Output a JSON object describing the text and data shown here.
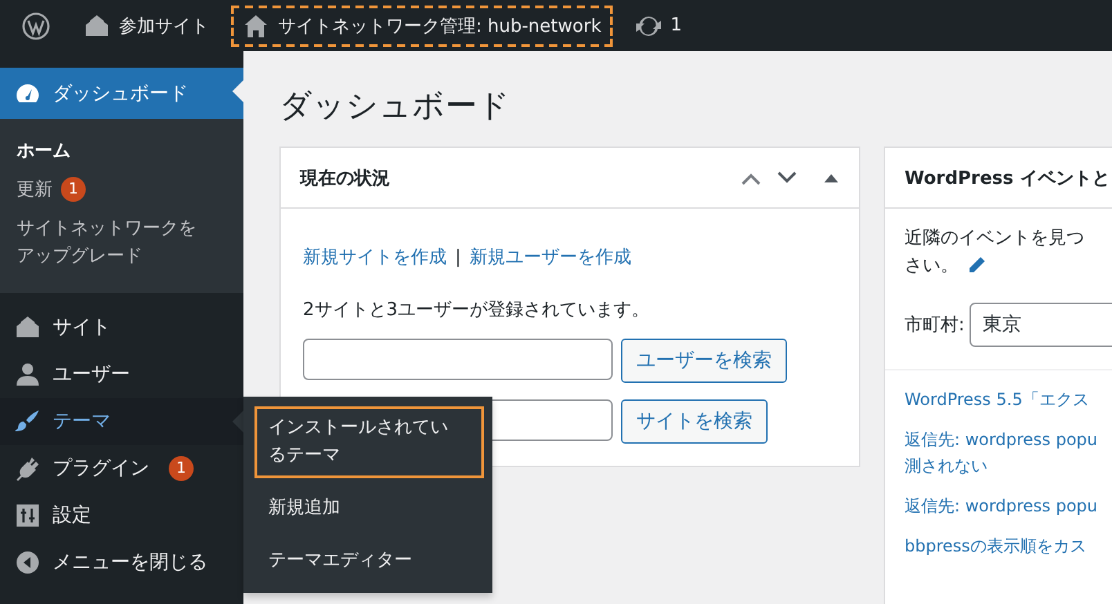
{
  "admin_bar": {
    "items": [
      {
        "kind": "logo"
      },
      {
        "kind": "sites",
        "label": "参加サイト",
        "highlighted": false
      },
      {
        "kind": "home",
        "label": "サイトネットワーク管理: hub-network",
        "highlighted": true
      },
      {
        "kind": "updates",
        "label": "1",
        "highlighted": false
      }
    ]
  },
  "sidebar": {
    "items": [
      {
        "label": "ダッシュボード",
        "selected": true,
        "expanded": false,
        "submenu": [
          {
            "label": "ホーム",
            "selected": true
          },
          {
            "label": "更新",
            "selected": false,
            "badge": "1"
          },
          {
            "label": "サイトネットワークをアップグレード",
            "selected": false
          }
        ]
      },
      {
        "label": "サイト",
        "selected": false,
        "expanded": false
      },
      {
        "label": "ユーザー",
        "selected": false,
        "expanded": false
      },
      {
        "label": "テーマ",
        "selected": false,
        "expanded": true,
        "flyout": [
          {
            "label": "インストールされているテーマ",
            "highlighted": true
          },
          {
            "label": "新規追加",
            "highlighted": false
          },
          {
            "label": "テーマエディター",
            "highlighted": false
          }
        ]
      },
      {
        "label": "プラグイン",
        "selected": false,
        "expanded": false,
        "badge": "1"
      },
      {
        "label": "設定",
        "selected": false,
        "expanded": false
      },
      {
        "label": "メニューを閉じる",
        "selected": false,
        "expanded": false
      }
    ]
  },
  "page": {
    "title": "ダッシュボード"
  },
  "status_widget": {
    "title": "現在の状況",
    "links": [
      "新規サイトを作成",
      "新規ユーザーを作成"
    ],
    "separator": "|",
    "summary": "2サイトと3ユーザーが登録されています。",
    "searches": [
      {
        "button": "ユーザーを検索"
      },
      {
        "button": "サイトを検索"
      }
    ]
  },
  "events_widget": {
    "title": "WordPress イベントと",
    "intro": [
      "近隣のイベントを見つ",
      "さい。"
    ],
    "city_label": "市町村:",
    "city_value": "東京",
    "news": [
      "WordPress 5.5「エクス",
      "返信先: wordpress popu\n測されない",
      "返信先: wordpress popu",
      "bbpressの表示順をカス"
    ]
  }
}
